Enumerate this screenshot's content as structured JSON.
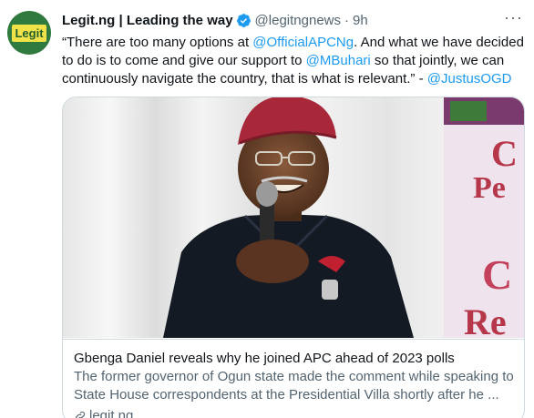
{
  "tweet": {
    "author": {
      "display_name": "Legit.ng | Leading the way",
      "handle": "@legitngnews",
      "separator": "·",
      "time": "9h",
      "avatar_text": "Legit",
      "verified": true
    },
    "text": {
      "p1": "“There are too many options at ",
      "m1": "@OfficialAPCNg",
      "p2": ". And what we have decided to do is to come and give our support to ",
      "m2": "@MBuhari",
      "p3": " so that jointly, we can continuously navigate the country, that is what is relevant.” - ",
      "m3": "@JustusOGD"
    },
    "card": {
      "title": "Gbenga Daniel reveals why he joined APC ahead of 2023 polls",
      "description": "The former governor of Ogun state made the comment while speaking to State House correspondents at the Presidential Villa shortly after he ...",
      "domain": "legit.ng",
      "image_banner_texts": [
        "C",
        "Pe",
        "C",
        "Re"
      ]
    },
    "icons": {
      "more": "more-icon",
      "verified": "verified-badge-icon",
      "link": "link-icon"
    },
    "colors": {
      "link": "#1d9bf0",
      "secondary_text": "#536471",
      "avatar_bg": "#2f7a3e",
      "verified": "#1d9bf0"
    }
  }
}
